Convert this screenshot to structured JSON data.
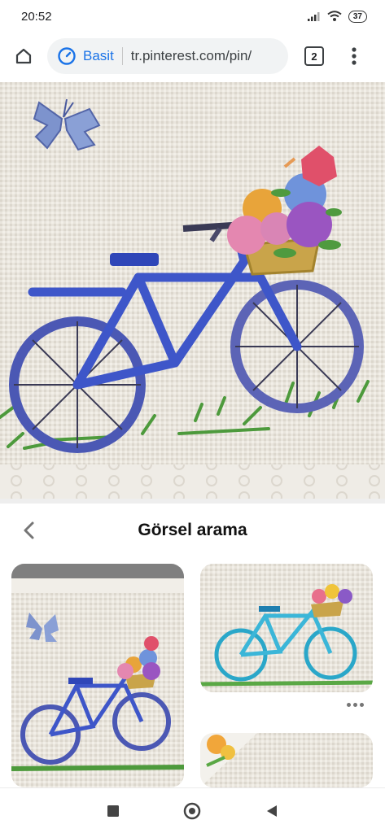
{
  "status": {
    "time": "20:52",
    "battery": "37"
  },
  "browser": {
    "security_label": "Basit",
    "url": "tr.pinterest.com/pin/",
    "tab_count": "2"
  },
  "search": {
    "title": "Görsel arama"
  },
  "icons": {
    "home": "home-icon",
    "info": "info-icon",
    "tabs": "tabs-icon",
    "menu": "more-vert-icon",
    "back": "chevron-left-icon",
    "more": "more-horiz-icon",
    "nav_recent": "square-icon",
    "nav_home": "circle-icon",
    "nav_back": "triangle-back-icon"
  },
  "colors": {
    "accent": "#1a73e8",
    "canvas": "#e8e4dc"
  }
}
